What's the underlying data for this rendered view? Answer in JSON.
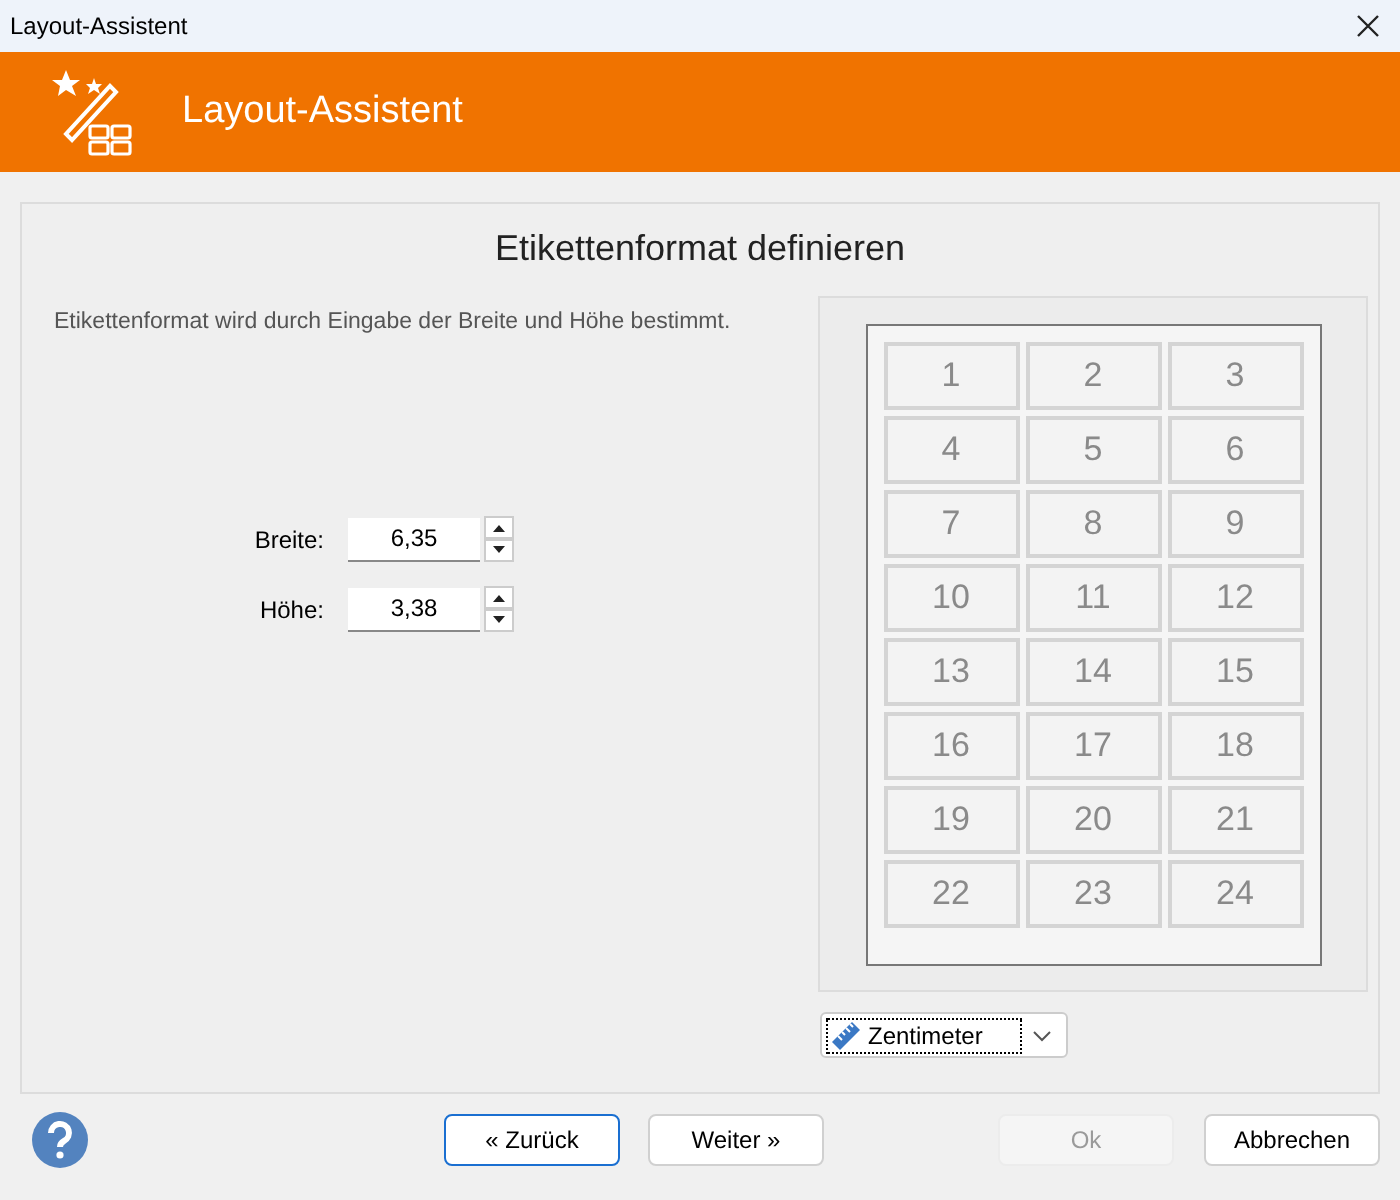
{
  "window": {
    "title": "Layout-Assistent"
  },
  "header": {
    "title": "Layout-Assistent"
  },
  "page": {
    "heading": "Etikettenformat definieren",
    "description": "Etikettenformat wird durch Eingabe der Breite und Höhe bestimmt."
  },
  "fields": [
    {
      "label": "Breite:",
      "value": "6,35"
    },
    {
      "label": "Höhe:",
      "value": "3,38"
    }
  ],
  "preview": {
    "labels": [
      "1",
      "2",
      "3",
      "4",
      "5",
      "6",
      "7",
      "8",
      "9",
      "10",
      "11",
      "12",
      "13",
      "14",
      "15",
      "16",
      "17",
      "18",
      "19",
      "20",
      "21",
      "22",
      "23",
      "24"
    ]
  },
  "unit": {
    "value": "Zentimeter"
  },
  "buttons": [
    {
      "label": "« Zurück",
      "default": true,
      "disabled": false
    },
    {
      "label": "Weiter »",
      "default": false,
      "disabled": false
    },
    {
      "label": "Ok",
      "default": false,
      "disabled": true
    },
    {
      "label": "Abbrechen",
      "default": false,
      "disabled": false
    }
  ]
}
